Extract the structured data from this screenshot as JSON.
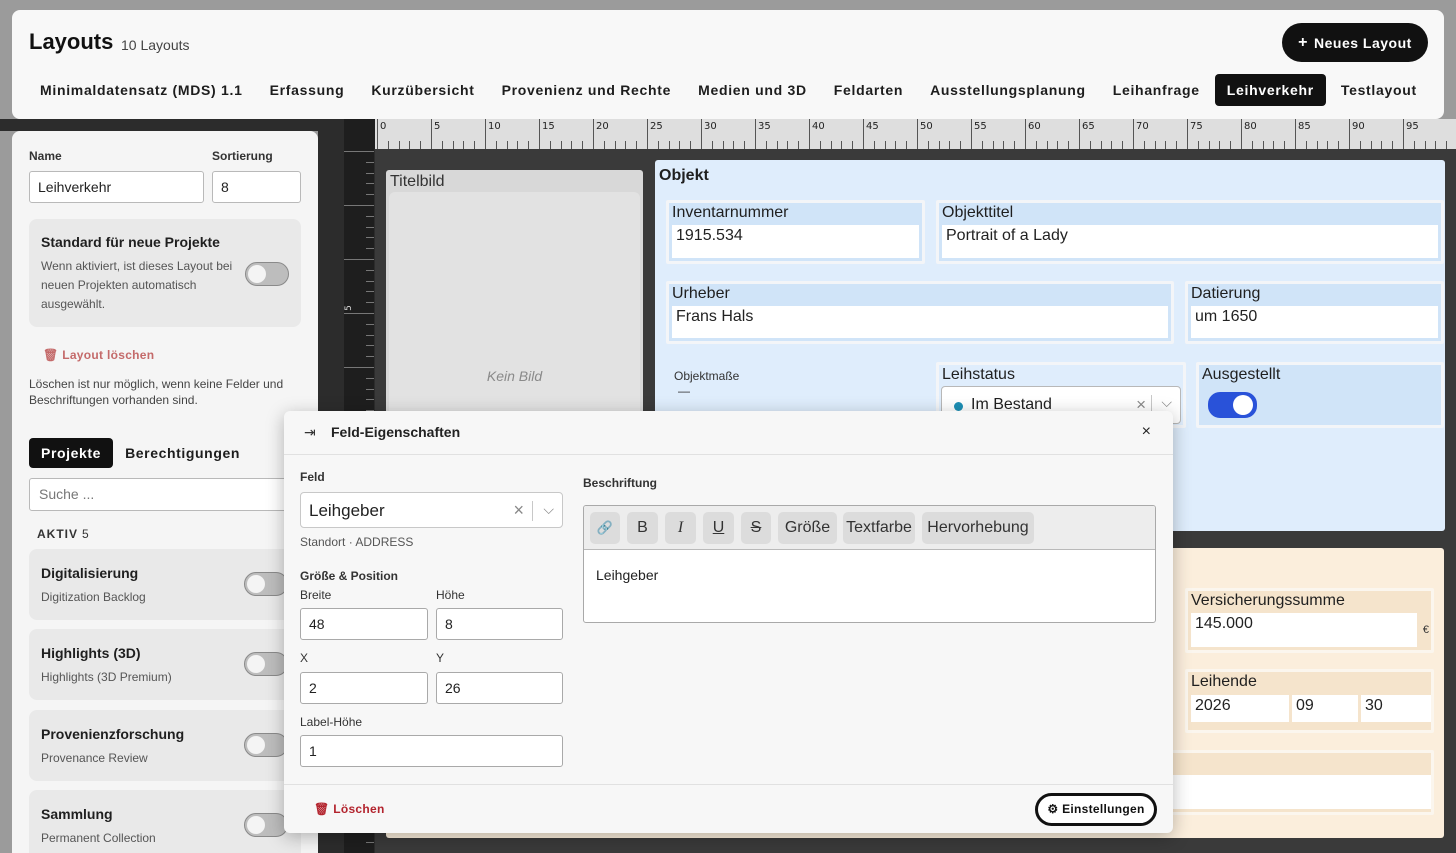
{
  "header": {
    "title": "Layouts",
    "count": "10 Layouts",
    "new_button": "Neues Layout",
    "tabs": [
      {
        "label": "Minimaldatensatz (MDS) 1.1"
      },
      {
        "label": "Erfassung"
      },
      {
        "label": "Kurzübersicht"
      },
      {
        "label": "Provenienz und Rechte"
      },
      {
        "label": "Medien und 3D"
      },
      {
        "label": "Feldarten"
      },
      {
        "label": "Ausstellungsplanung"
      },
      {
        "label": "Leihanfrage"
      },
      {
        "label": "Leihverkehr"
      },
      {
        "label": "Testlayout"
      }
    ],
    "active_tab": "Leihverkehr"
  },
  "left": {
    "name_label": "Name",
    "name_value": "Leihverkehr",
    "sort_label": "Sortierung",
    "sort_value": "8",
    "standard_title": "Standard für neue Projekte",
    "standard_desc": "Wenn aktiviert, ist dieses Layout bei neuen Projekten automatisch ausgewählt.",
    "standard_on": false,
    "delete_label": "Layout löschen",
    "delete_note": "Löschen ist nur möglich, wenn keine Felder und Beschriftungen vorhanden sind.",
    "seg_projects": "Projekte",
    "seg_permissions": "Berechtigungen",
    "search_placeholder": "Suche ...",
    "active_label": "AKTIV",
    "active_count": "5",
    "projects": [
      {
        "name": "Digitalisierung",
        "sub": "Digitization Backlog"
      },
      {
        "name": "Highlights (3D)",
        "sub": "Highlights (3D Premium)"
      },
      {
        "name": "Provenienzforschung",
        "sub": "Provenance Review"
      },
      {
        "name": "Sammlung",
        "sub": "Permanent Collection"
      }
    ]
  },
  "ruler": {
    "top": [
      "0",
      "5",
      "10",
      "15",
      "20",
      "25",
      "30",
      "35",
      "40",
      "45",
      "50",
      "55",
      "60",
      "65",
      "70",
      "75",
      "80",
      "85",
      "90",
      "95"
    ],
    "left": [
      "5"
    ]
  },
  "canvas": {
    "titelbild_label": "Titelbild",
    "kein_bild": "Kein Bild",
    "objekt": {
      "title": "Objekt",
      "inventar_label": "Inventarnummer",
      "inventar_value": "1915.534",
      "titel_label": "Objekttitel",
      "titel_value": "Portrait of a Lady",
      "urheber_label": "Urheber",
      "urheber_value": "Frans Hals",
      "datierung_label": "Datierung",
      "datierung_value": "um 1650",
      "masse_label": "Objektmaße",
      "masse_value": "—",
      "leihstatus_label": "Leihstatus",
      "leihstatus_value": "Im Bestand",
      "ausgestellt_label": "Ausgestellt",
      "ausgestellt_on": true
    },
    "leihe": {
      "versicherung_label": "Versicherungssumme",
      "versicherung_value": "145.000",
      "versicherung_unit": "€",
      "leihende_label": "Leihende",
      "leihende_year": "2026",
      "leihende_month": "09",
      "leihende_day": "30"
    }
  },
  "modal": {
    "title": "Feld-Eigenschaften",
    "close": "×",
    "feld_label": "Feld",
    "feld_value": "Leihgeber",
    "feld_meta": "Standort · ADDRESS",
    "groesse_label": "Größe & Position",
    "breite_label": "Breite",
    "breite_value": "48",
    "hoehe_label": "Höhe",
    "hoehe_value": "8",
    "x_label": "X",
    "x_value": "2",
    "y_label": "Y",
    "y_value": "26",
    "labelhoehe_label": "Label-Höhe",
    "labelhoehe_value": "1",
    "beschriftung_label": "Beschriftung",
    "toolbar": {
      "link": "🔗",
      "bold": "B",
      "italic": "I",
      "underline": "U",
      "strike": "S",
      "size": "Größe",
      "color": "Textfarbe",
      "highlight": "Hervorhebung"
    },
    "editor_text": "Leihgeber",
    "delete_label": "Löschen",
    "settings_label": "Einstellungen"
  }
}
